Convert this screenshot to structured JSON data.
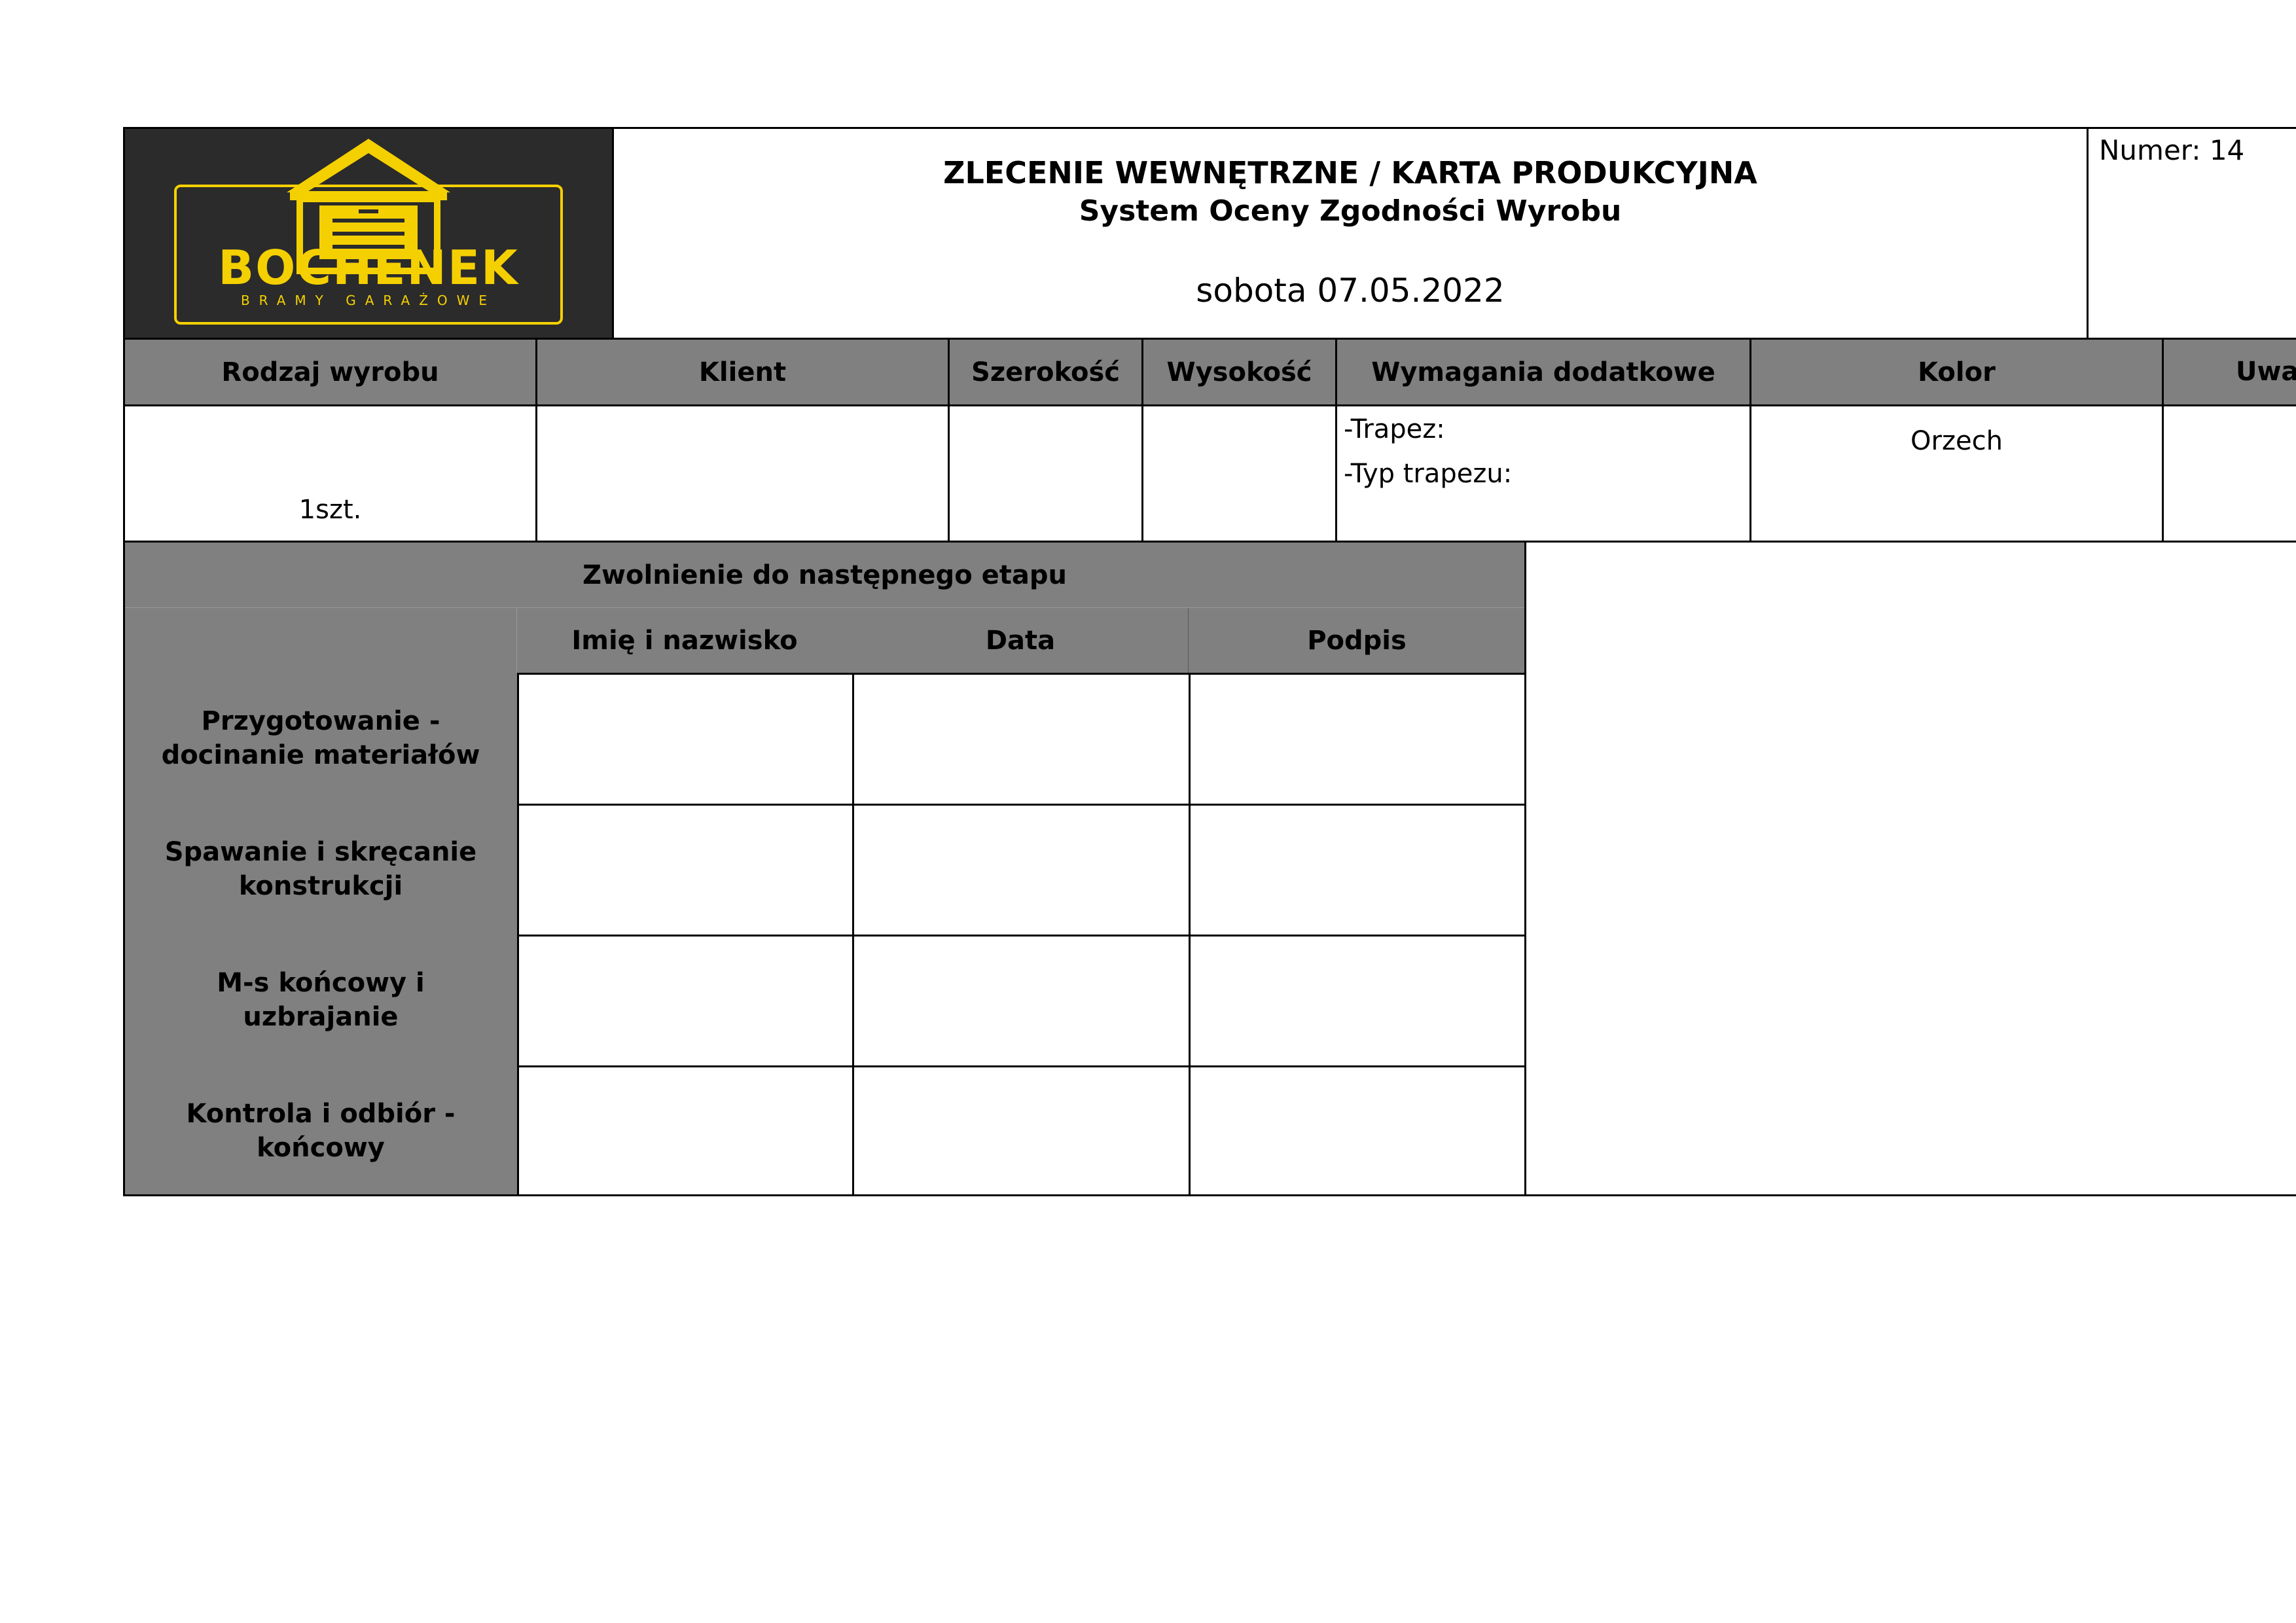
{
  "logo": {
    "brand": "BOCHENEK",
    "tagline": "BRAMY GARAŻOWE"
  },
  "header": {
    "title": "ZLECENIE WEWNĘTRZNE / KARTA PRODUKCYJNA",
    "subtitle": "System Oceny Zgodności Wyrobu",
    "date": "sobota 07.05.2022",
    "number": "Numer: 14"
  },
  "product_table": {
    "columns": [
      "Rodzaj wyrobu",
      "Klient",
      "Szerokość",
      "Wysokość",
      "Wymagania dodatkowe",
      "Kolor",
      "Uwa"
    ],
    "row": {
      "rodzaj": "1szt.",
      "klient": "",
      "szerokosc": "",
      "wysokosc": "",
      "wymagania": [
        "-Trapez:",
        "-Typ trapezu:"
      ],
      "kolor": "Orzech",
      "uwagi": ""
    }
  },
  "release_table": {
    "title": "Zwolnienie do następnego etapu",
    "columns": [
      "",
      "Imię i nazwisko",
      "Data",
      "Podpis"
    ],
    "rows": [
      {
        "stage": "Przygotowanie - docinanie materiałów"
      },
      {
        "stage": "Spawanie i skręcanie konstrukcji"
      },
      {
        "stage": "M-s końcowy i uzbrajanie"
      },
      {
        "stage": "Kontrola i odbiór - końcowy"
      }
    ]
  },
  "colors": {
    "logo_bg": "#2b2b2b",
    "logo_yellow": "#f5d000",
    "header_grey": "#808080"
  }
}
